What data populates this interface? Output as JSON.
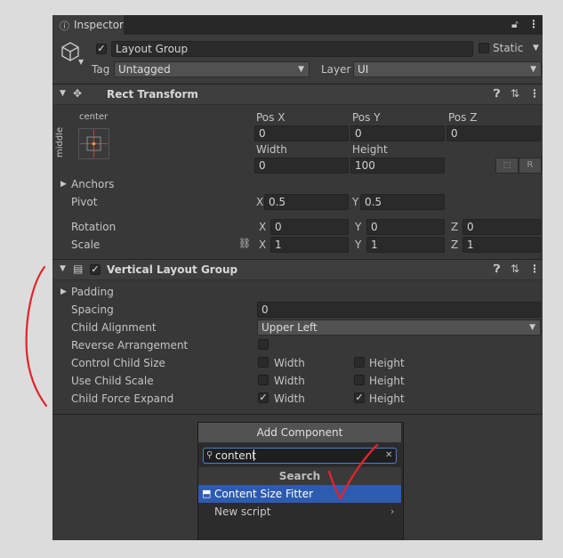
{
  "inspector": {
    "tab_title": "Inspector"
  },
  "gameobject": {
    "name": "Layout Group",
    "static_label": "Static",
    "tag_label": "Tag",
    "tag_value": "Untagged",
    "layer_label": "Layer",
    "layer_value": "UI"
  },
  "rect_transform": {
    "title": "Rect Transform",
    "anchor_h": "center",
    "anchor_v": "middle",
    "posx_label": "Pos X",
    "posx": "0",
    "posy_label": "Pos Y",
    "posy": "0",
    "posz_label": "Pos Z",
    "posz": "0",
    "width_label": "Width",
    "width": "0",
    "height_label": "Height",
    "height": "100",
    "r_button": "R",
    "anchors_label": "Anchors",
    "pivot_label": "Pivot",
    "pivot_x_axis": "X",
    "pivot_x": "0.5",
    "pivot_y_axis": "Y",
    "pivot_y": "0.5",
    "rotation_label": "Rotation",
    "rot_x_axis": "X",
    "rot_x": "0",
    "rot_y_axis": "Y",
    "rot_y": "0",
    "rot_z_axis": "Z",
    "rot_z": "0",
    "scale_label": "Scale",
    "scale_x_axis": "X",
    "scale_x": "1",
    "scale_y_axis": "Y",
    "scale_y": "1",
    "scale_z_axis": "Z",
    "scale_z": "1"
  },
  "vlg": {
    "title": "Vertical Layout Group",
    "padding_label": "Padding",
    "spacing_label": "Spacing",
    "spacing_value": "0",
    "child_alignment_label": "Child Alignment",
    "child_alignment_value": "Upper Left",
    "reverse_label": "Reverse Arrangement",
    "control_size_label": "Control Child Size",
    "use_scale_label": "Use Child Scale",
    "force_expand_label": "Child Force Expand",
    "width_opt": "Width",
    "height_opt": "Height",
    "checks": {
      "reverse": false,
      "control_width": false,
      "control_height": false,
      "scale_width": false,
      "scale_height": false,
      "expand_width": true,
      "expand_height": true
    }
  },
  "add_component": {
    "title": "Add Component",
    "search_value": "content",
    "section": "Search",
    "result_1": "Content Size Fitter",
    "result_2": "New script"
  },
  "colors": {
    "panel_bg": "#383838",
    "selection": "#2d5bb0",
    "annotation": "#e0252b"
  }
}
